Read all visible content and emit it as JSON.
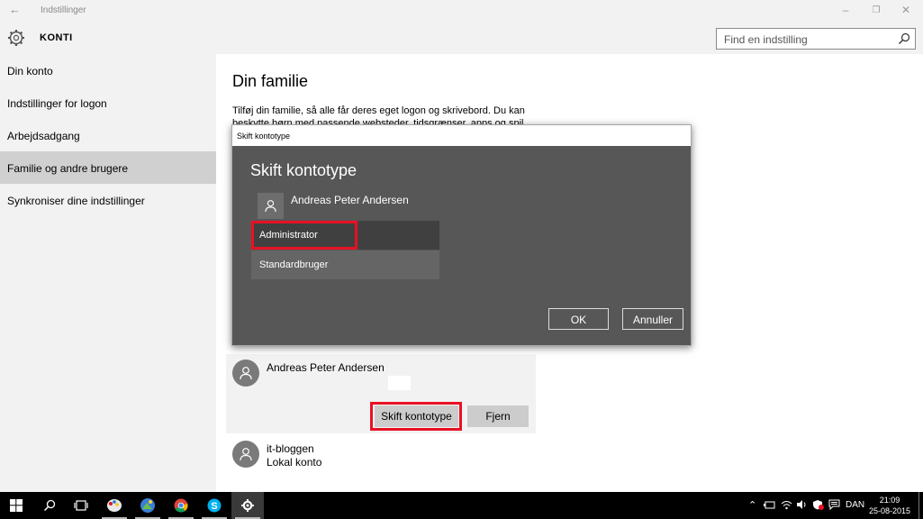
{
  "window": {
    "title": "Indstillinger",
    "controls": [
      "minimize",
      "restore",
      "close"
    ]
  },
  "header": {
    "section": "KONTI",
    "search_placeholder": "Find en indstilling"
  },
  "sidebar": {
    "items": [
      {
        "label": "Din konto",
        "active": false
      },
      {
        "label": "Indstillinger for logon",
        "active": false
      },
      {
        "label": "Arbejdsadgang",
        "active": false
      },
      {
        "label": "Familie og andre brugere",
        "active": true
      },
      {
        "label": "Synkroniser dine indstillinger",
        "active": false
      }
    ]
  },
  "main": {
    "title": "Din familie",
    "description": "Tilføj din familie, så alle får deres eget logon og skrivebord. Du kan beskytte børn med passende websteder, tidsgrænser, apps og spil."
  },
  "user_card": {
    "name": "Andreas Peter Andersen",
    "change_button": "Skift kontotype",
    "remove_button": "Fjern"
  },
  "other_user": {
    "name": "it-bloggen",
    "type": "Lokal konto"
  },
  "dialog": {
    "window_title": "Skift kontotype",
    "heading": "Skift kontotype",
    "user_name": "Andreas Peter Andersen",
    "options": [
      "Administrator",
      "Standardbruger"
    ],
    "selected_option": "Administrator",
    "ok_label": "OK",
    "cancel_label": "Annuller"
  },
  "taskbar": {
    "apps": [
      "start-icon",
      "search-icon",
      "task-view-icon",
      "paint-icon",
      "photos-icon",
      "chrome-icon",
      "skype-icon",
      "settings-icon"
    ],
    "language": "DAN",
    "time": "21:09",
    "date": "25-08-2015"
  },
  "colors": {
    "highlight_red": "#e81123",
    "dialog_bg": "#575757",
    "sidebar_bg": "#f2f2f2",
    "active_nav": "#d0d0d0"
  }
}
